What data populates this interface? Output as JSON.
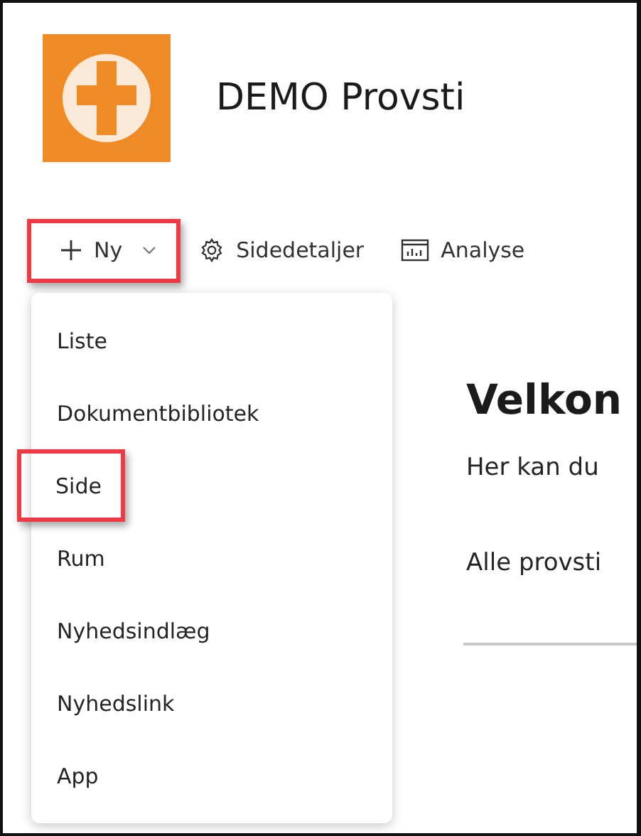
{
  "site": {
    "title": "DEMO Provsti"
  },
  "command_bar": [
    {
      "kind": "new",
      "label": "Ny",
      "highlighted": true
    },
    {
      "kind": "settings",
      "label": "Sidedetaljer",
      "highlighted": false
    },
    {
      "kind": "analytics",
      "label": "Analyse",
      "highlighted": false
    }
  ],
  "new_menu": [
    {
      "label": "Liste",
      "highlighted": false
    },
    {
      "label": "Dokumentbibliotek",
      "highlighted": false
    },
    {
      "label": "Side",
      "highlighted": true
    },
    {
      "label": "Rum",
      "highlighted": false
    },
    {
      "label": "Nyhedsindlæg",
      "highlighted": false
    },
    {
      "label": "Nyhedslink",
      "highlighted": false
    },
    {
      "label": "App",
      "highlighted": false
    }
  ],
  "content": {
    "heading": "Velkon",
    "paragraphs": [
      "Her kan du",
      "Alle provsti"
    ]
  }
}
